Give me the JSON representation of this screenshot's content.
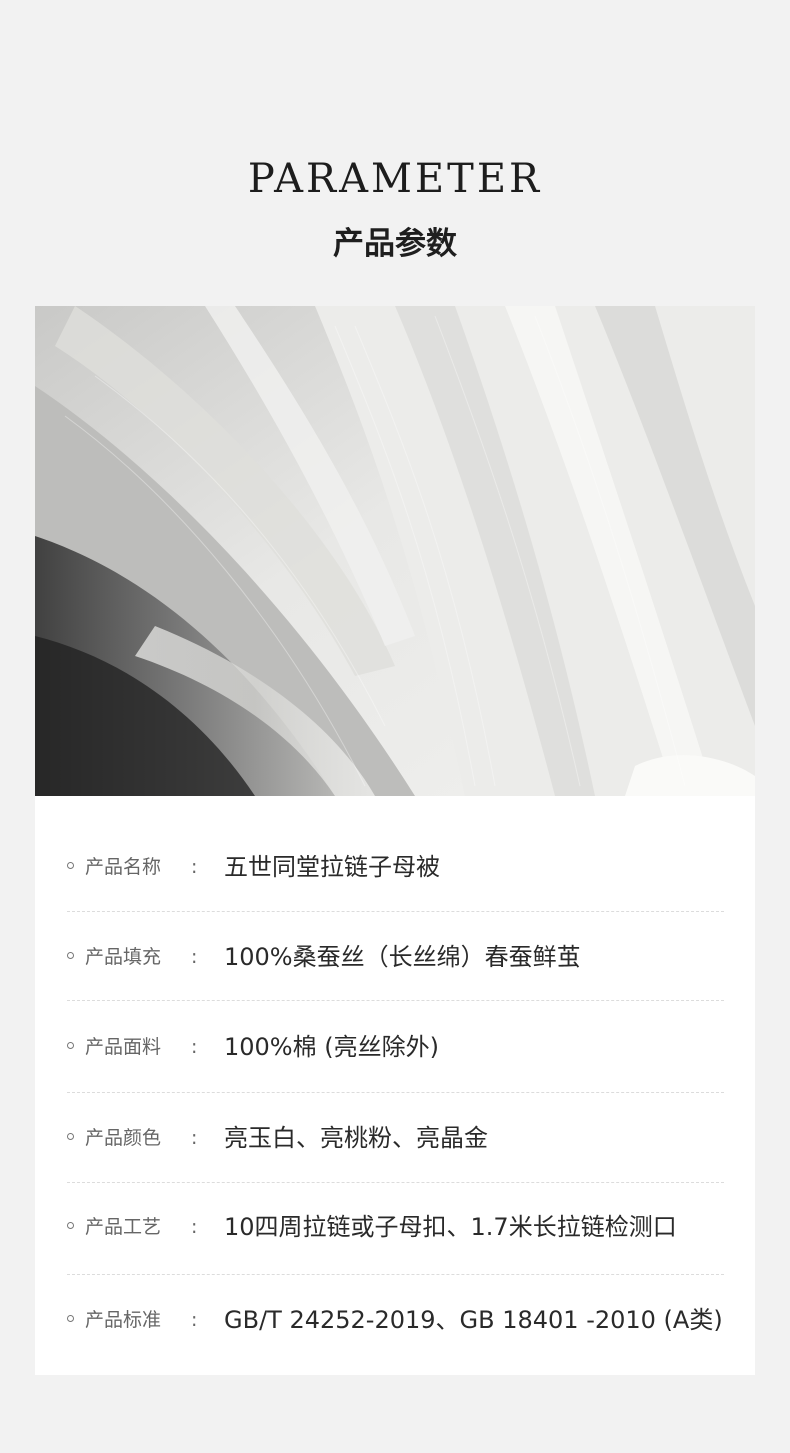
{
  "heading": {
    "english": "PARAMETER",
    "chinese": "产品参数"
  },
  "photo": {
    "icon": "white-silk-fabric-photo"
  },
  "colon": ":",
  "parameters": [
    {
      "label": "产品名称",
      "value": "五世同堂拉链子母被"
    },
    {
      "label": "产品填充",
      "value": "100%桑蚕丝（长丝绵）春蚕鲜茧"
    },
    {
      "label": "产品面料",
      "value": "100%棉 (亮丝除外)"
    },
    {
      "label": "产品颜色",
      "value": "亮玉白、亮桃粉、亮晶金"
    },
    {
      "label": "产品工艺",
      "value": "10四周拉链或子母扣、1.7米长拉链检测口"
    },
    {
      "label": "产品标准",
      "value": "GB/T 24252-2019、GB 18401 -2010 (A类)"
    }
  ]
}
